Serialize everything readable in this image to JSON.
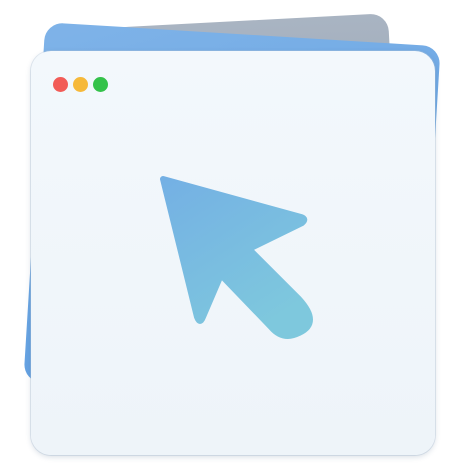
{
  "app": {
    "icon_name": "mouse-pointer-app-icon"
  },
  "window": {
    "controls": [
      {
        "name": "close",
        "color": "#f25c57"
      },
      {
        "name": "minimize",
        "color": "#f6b93a"
      },
      {
        "name": "maximize",
        "color": "#34c24a"
      }
    ]
  },
  "cursor": {
    "icon": "arrow-cursor-icon",
    "gradient_top": "#74b0e4",
    "gradient_bottom": "#7ec8dd"
  },
  "colors": {
    "back_card_blue": "#6aa6e4",
    "back_card_gray": "#a3afbd",
    "window_bg": "#f2f7fb"
  }
}
